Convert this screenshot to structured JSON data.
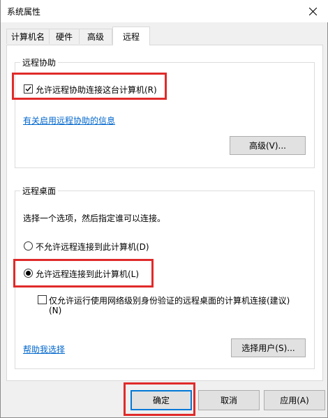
{
  "window": {
    "title": "系统属性"
  },
  "tabs": [
    {
      "label": "计算机名"
    },
    {
      "label": "硬件"
    },
    {
      "label": "高级"
    },
    {
      "label": "远程"
    }
  ],
  "remote_assistance": {
    "group_title": "远程协助",
    "allow_checkbox_label": "允许远程协助连接这台计算机(R)",
    "allow_checked": true,
    "info_link": "有关启用远程协助的信息",
    "advanced_button": "高级(V)..."
  },
  "remote_desktop": {
    "group_title": "远程桌面",
    "instruction": "选择一个选项，然后指定谁可以连接。",
    "option_disallow": "不允许远程连接到此计算机(D)",
    "option_allow": "允许远程连接到此计算机(L)",
    "selected_option": "allow",
    "nla_checkbox_label_line1": "仅允许运行使用网络级别身份验证的远程桌面的计算机连接(建议)",
    "nla_checkbox_label_line2": "(N)",
    "nla_checked": false,
    "help_link": "帮助我选择",
    "select_users_button": "选择用户(S)..."
  },
  "footer": {
    "ok_button": "确定",
    "cancel_button": "取消",
    "apply_button": "应用(A)"
  },
  "colors": {
    "highlight": "#e02a2a",
    "link": "#0066cc"
  }
}
